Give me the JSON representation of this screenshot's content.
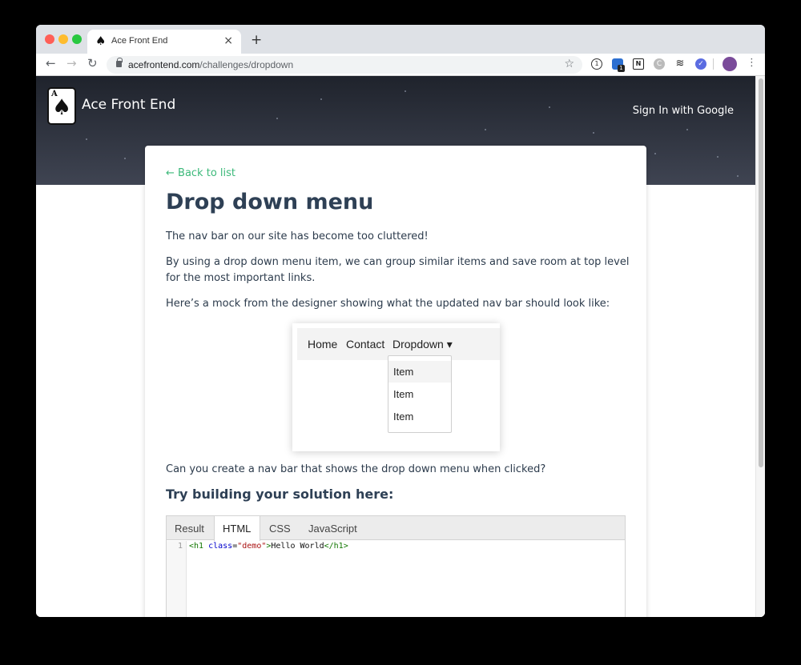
{
  "browser": {
    "tab_title": "Ace Front End",
    "tab_close": "×",
    "new_tab": "+",
    "url_host": "acefrontend.com",
    "url_path": "/challenges/dropdown",
    "ext_badge": "1"
  },
  "site": {
    "logo_letter": "A",
    "brand": "Ace Front End",
    "sign_in": "Sign In with Google"
  },
  "challenge": {
    "back_link": "← Back to list",
    "title": "Drop down menu",
    "p1": "The nav bar on our site has become too cluttered!",
    "p2": "By using a drop down menu item, we can group similar items and save room at top level for the most important links.",
    "p3": "Here’s a mock from the designer showing what the updated nav bar should look like:",
    "p4": "Can you create a nav bar that shows the drop down menu when clicked?",
    "subtitle": "Try building your solution here:"
  },
  "mock": {
    "nav": [
      "Home",
      "Contact",
      "Dropdown ▾"
    ],
    "items": [
      "Item",
      "Item",
      "Item"
    ]
  },
  "editor": {
    "tabs": [
      "Result",
      "HTML",
      "CSS",
      "JavaScript"
    ],
    "active_tab": "HTML",
    "line_number": "1",
    "code": {
      "open_tag": "<h1",
      "attr": "class",
      "eq": "=",
      "value": "\"demo\"",
      "close_bracket": ">",
      "text": "Hello World",
      "end_tag": "</h1>"
    }
  },
  "colors": {
    "accent_green": "#3cb97a",
    "heading": "#2e4055",
    "hero_dark": "#1f232c"
  }
}
